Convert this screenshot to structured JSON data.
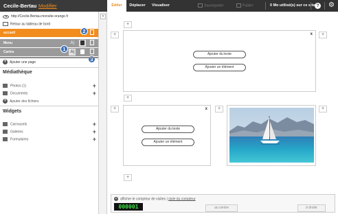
{
  "header": {
    "brand": "Cecile-Bertau",
    "modifier_link": "Modifier",
    "tabs": [
      {
        "label": "Éditer",
        "active": true
      },
      {
        "label": "Déplacer",
        "active": false
      },
      {
        "label": "Visualiser",
        "active": false
      }
    ],
    "save_label": "Sauvegarder",
    "publish_label": "Publier",
    "usage_text": "0 Mo utilisé(s) sur ce site",
    "help_label": "?",
    "accent_color": "#f28c1c"
  },
  "sidebar": {
    "site_url": "http://Cecile-Bertau.monsite-orange.fr",
    "back_label": "Retour au tableau de bord",
    "collapse_icon": "«",
    "pages": [
      {
        "label": "accueil",
        "state": "active"
      },
      {
        "label": "Menu",
        "state": "hover"
      },
      {
        "label": "Cartes",
        "state": "normal"
      }
    ],
    "action_labels": {
      "rename": "A",
      "text": "A|"
    },
    "badges": [
      "1",
      "2",
      "3"
    ],
    "add_page_label": "Ajouter une page",
    "mediatheque": {
      "title": "Médiathèque",
      "items": [
        {
          "label": "Photos (1)",
          "icon": "photo-icon"
        },
        {
          "label": "Documents",
          "icon": "document-icon"
        }
      ],
      "add_files_label": "Ajouter des fichiers"
    },
    "widgets": {
      "title": "Widgets",
      "items": [
        {
          "label": "Carrousels",
          "icon": "carousel-icon"
        },
        {
          "label": "Galeries",
          "icon": "gallery-icon"
        },
        {
          "label": "Formulaires",
          "icon": "form-icon"
        }
      ]
    }
  },
  "canvas": {
    "plus": "+",
    "close": "x",
    "add_text_label": "Ajouter du texte",
    "add_element_label": "Ajouter un élément"
  },
  "counter": {
    "label": "afficher le compteur de visites",
    "style_label": "style du compteur",
    "separator": " | ",
    "value": "000001",
    "center_label": "au centre",
    "right_label": "à droite"
  }
}
